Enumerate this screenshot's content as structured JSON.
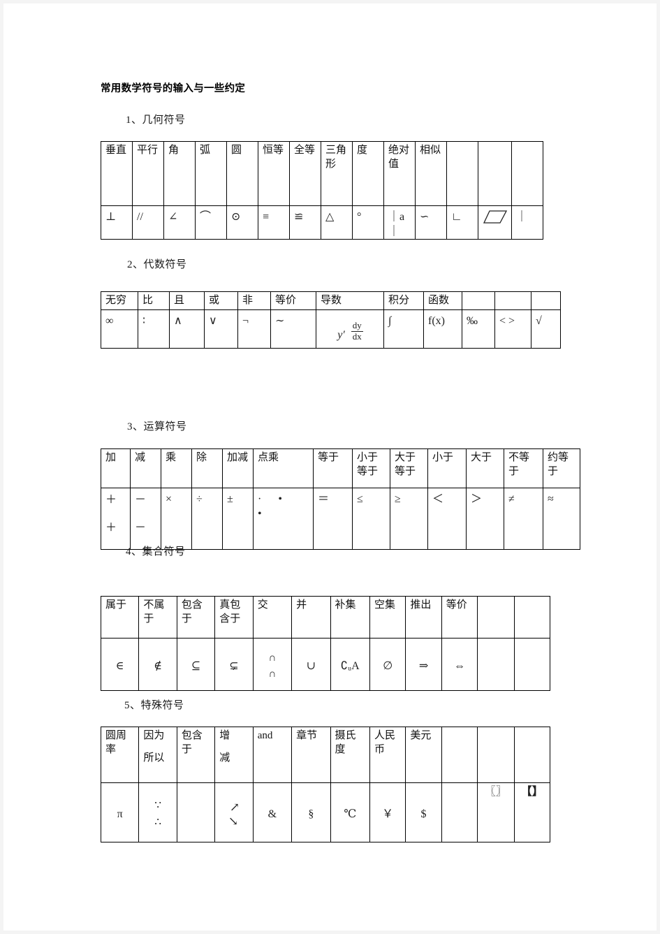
{
  "document": {
    "title": "常用数学符号的输入与一些约定"
  },
  "sections": [
    {
      "label": "1、几何符号"
    },
    {
      "label": "2、代数符号"
    },
    {
      "label": "3、运算符号"
    },
    {
      "label": "4、集合符号"
    },
    {
      "label": "5、特殊符号"
    }
  ],
  "tables": {
    "geometry": {
      "headers": [
        "垂直",
        "平行",
        "角",
        "弧",
        "圆",
        "恒等",
        "全等",
        "三角形",
        "度",
        "绝对值",
        "相似",
        "",
        "",
        ""
      ],
      "symbols": [
        "⊥",
        "//",
        "∠",
        "⌒",
        "⊙",
        "≡",
        "≌",
        "△",
        "°",
        "｜a｜",
        "∽",
        "∟",
        "▱",
        "｜"
      ]
    },
    "algebra": {
      "headers": [
        "无穷",
        "比",
        "且",
        "或",
        "非",
        "等价",
        "导数",
        "积分",
        "函数",
        "",
        "",
        ""
      ],
      "symbols": [
        "∞",
        "∶",
        "∧",
        "∨",
        "¬",
        "∼",
        "y′ dy/dx",
        "∫",
        "f(x)",
        "‰",
        "< >",
        "√"
      ],
      "derivative": {
        "prime": "y′",
        "numerator": "dy",
        "denominator": "dx"
      }
    },
    "operation": {
      "headers": [
        "加",
        "减",
        "乘",
        "除",
        "加减",
        "点乘",
        "等于",
        "小于等于",
        "大于等于",
        "小于",
        "大于",
        "不等于",
        "约等于"
      ],
      "symbols": [
        "＋",
        "－",
        "×",
        "÷",
        "±",
        "· • •",
        "＝",
        "≤",
        "≥",
        "＜",
        "＞",
        "≠",
        "≈"
      ],
      "symbols_second_line": [
        "＋",
        "－",
        "",
        "",
        "",
        "",
        "",
        "",
        "",
        "",
        "",
        "",
        ""
      ]
    },
    "set": {
      "headers": [
        "属于",
        "不属于",
        "包含于",
        "真包含于",
        "交",
        "并",
        "补集",
        "空集",
        "推出",
        "等价",
        "",
        ""
      ],
      "symbols": [
        "∈",
        "∉",
        "⊆",
        "⊊",
        "∩ ∩",
        "∪",
        "∁ᵤA",
        "∅",
        "⇒",
        "⇔",
        "",
        ""
      ]
    },
    "special": {
      "headers": [
        "圆周率",
        "因为所以",
        "包含于",
        "增减",
        "and",
        "章节",
        "摄氏度",
        "人民币",
        "美元",
        "",
        "",
        ""
      ],
      "symbols": [
        "π",
        "∵ ∴",
        "",
        "↗ ↘",
        "&",
        "§",
        "℃",
        "￥",
        "$",
        "",
        "〖〗",
        "【】"
      ],
      "header_lines": {
        "pi": [
          "圆周",
          "率"
        ],
        "because": [
          "因为",
          "所以"
        ],
        "contain": [
          "包含",
          "于"
        ],
        "delta": [
          "增",
          "减"
        ],
        "celsius": [
          "摄氏",
          "度"
        ],
        "rmb": [
          "人民",
          "币"
        ],
        "dollar": [
          "美元"
        ]
      }
    }
  },
  "colors": {
    "page_background": "#ffffff",
    "canvas_background": "#f4f4f4",
    "border": "#000000",
    "text": "#111111"
  }
}
